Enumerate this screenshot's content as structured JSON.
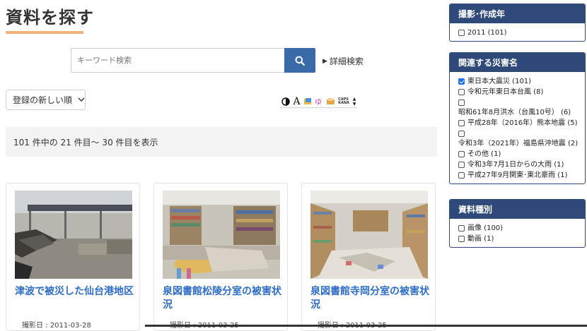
{
  "page": {
    "title": "資料を探す"
  },
  "search": {
    "placeholder": "キーワード検索",
    "value": "",
    "advanced_label": "詳細検索"
  },
  "sort": {
    "selected": "登録の新しい順"
  },
  "results": {
    "summary": "101 件中の 21 件目～ 30 件目を表示"
  },
  "toolbar": {
    "a_label": "A",
    "caps_label": "CAPS\nKANA"
  },
  "cards": [
    {
      "title": "津波で被災した仙台港地区",
      "date": "撮影日 : 2011-03-28"
    },
    {
      "title": "泉図書館松陵分室の被害状況",
      "date": "撮影日 : 2011-03-25"
    },
    {
      "title": "泉図書館寺岡分室の被害状況",
      "date": "撮影日 : 2011-03-25"
    }
  ],
  "sidebar": {
    "year": {
      "heading": "撮影･作成年",
      "options": [
        {
          "label": "2011 (101)",
          "checked": false
        }
      ]
    },
    "disaster": {
      "heading": "関連する災害名",
      "options": [
        {
          "label": "東日本大震災 (101)",
          "checked": true
        },
        {
          "label": "令和元年東日本台風 (8)",
          "checked": false
        },
        {
          "label": "昭和61年8月洪水（台風10号） (6)",
          "checked": false
        },
        {
          "label": "平成28年（2016年）熊本地震 (5)",
          "checked": false
        },
        {
          "label": "令和3年（2021年）福島県沖地震 (2)",
          "checked": false
        },
        {
          "label": "その他 (1)",
          "checked": false
        },
        {
          "label": "令和3年7月1日からの大雨 (1)",
          "checked": false
        },
        {
          "label": "平成27年9月関東･東北豪雨 (1)",
          "checked": false
        }
      ]
    },
    "type": {
      "heading": "資料種別",
      "options": [
        {
          "label": "画像 (100)",
          "checked": false
        },
        {
          "label": "動画 (1)",
          "checked": false
        }
      ]
    }
  },
  "colors": {
    "accent": "#3a6aa7",
    "panel_head": "#2f4a7a",
    "link": "#2e6dc9",
    "underline": "#f0b27a"
  }
}
